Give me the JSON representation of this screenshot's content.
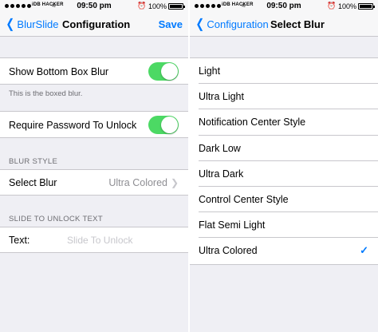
{
  "status_bar": {
    "carrier": "iDB HACKER",
    "time": "09:50 pm",
    "battery_percent": "100%",
    "battery_level": 1.0
  },
  "config_screen": {
    "nav": {
      "back_label": "BlurSlide",
      "title": "Configuration",
      "save_label": "Save"
    },
    "show_bottom_box_blur": {
      "label": "Show Bottom Box Blur",
      "enabled": true
    },
    "boxed_blur_note": "This is the boxed blur.",
    "require_password": {
      "label": "Require Password To Unlock",
      "enabled": true
    },
    "blur_style_header": "BLUR STYLE",
    "select_blur": {
      "label": "Select Blur",
      "value": "Ultra Colored"
    },
    "slide_text_header": "SLIDE TO UNLOCK TEXT",
    "text_field": {
      "label": "Text:",
      "placeholder": "Slide To Unlock"
    }
  },
  "select_screen": {
    "nav": {
      "back_label": "Configuration",
      "title": "Select Blur"
    },
    "options": [
      {
        "label": "Light",
        "selected": false
      },
      {
        "label": "Ultra Light",
        "selected": false
      },
      {
        "label": "Notification Center Style",
        "selected": false
      },
      {
        "label": "Dark Low",
        "selected": false
      },
      {
        "label": "Ultra Dark",
        "selected": false
      },
      {
        "label": "Control Center Style",
        "selected": false
      },
      {
        "label": "Flat Semi Light",
        "selected": false
      },
      {
        "label": "Ultra Colored",
        "selected": true
      }
    ]
  },
  "colors": {
    "accent": "#007aff",
    "switch_on": "#4cd964",
    "grouped_background": "#efeff4"
  },
  "icons": {
    "back": "chevron-left-icon",
    "disclosure": "chevron-right-icon",
    "selected": "checkmark-icon",
    "alarm": "alarm-icon",
    "wifi": "wifi-icon",
    "battery": "battery-icon"
  }
}
